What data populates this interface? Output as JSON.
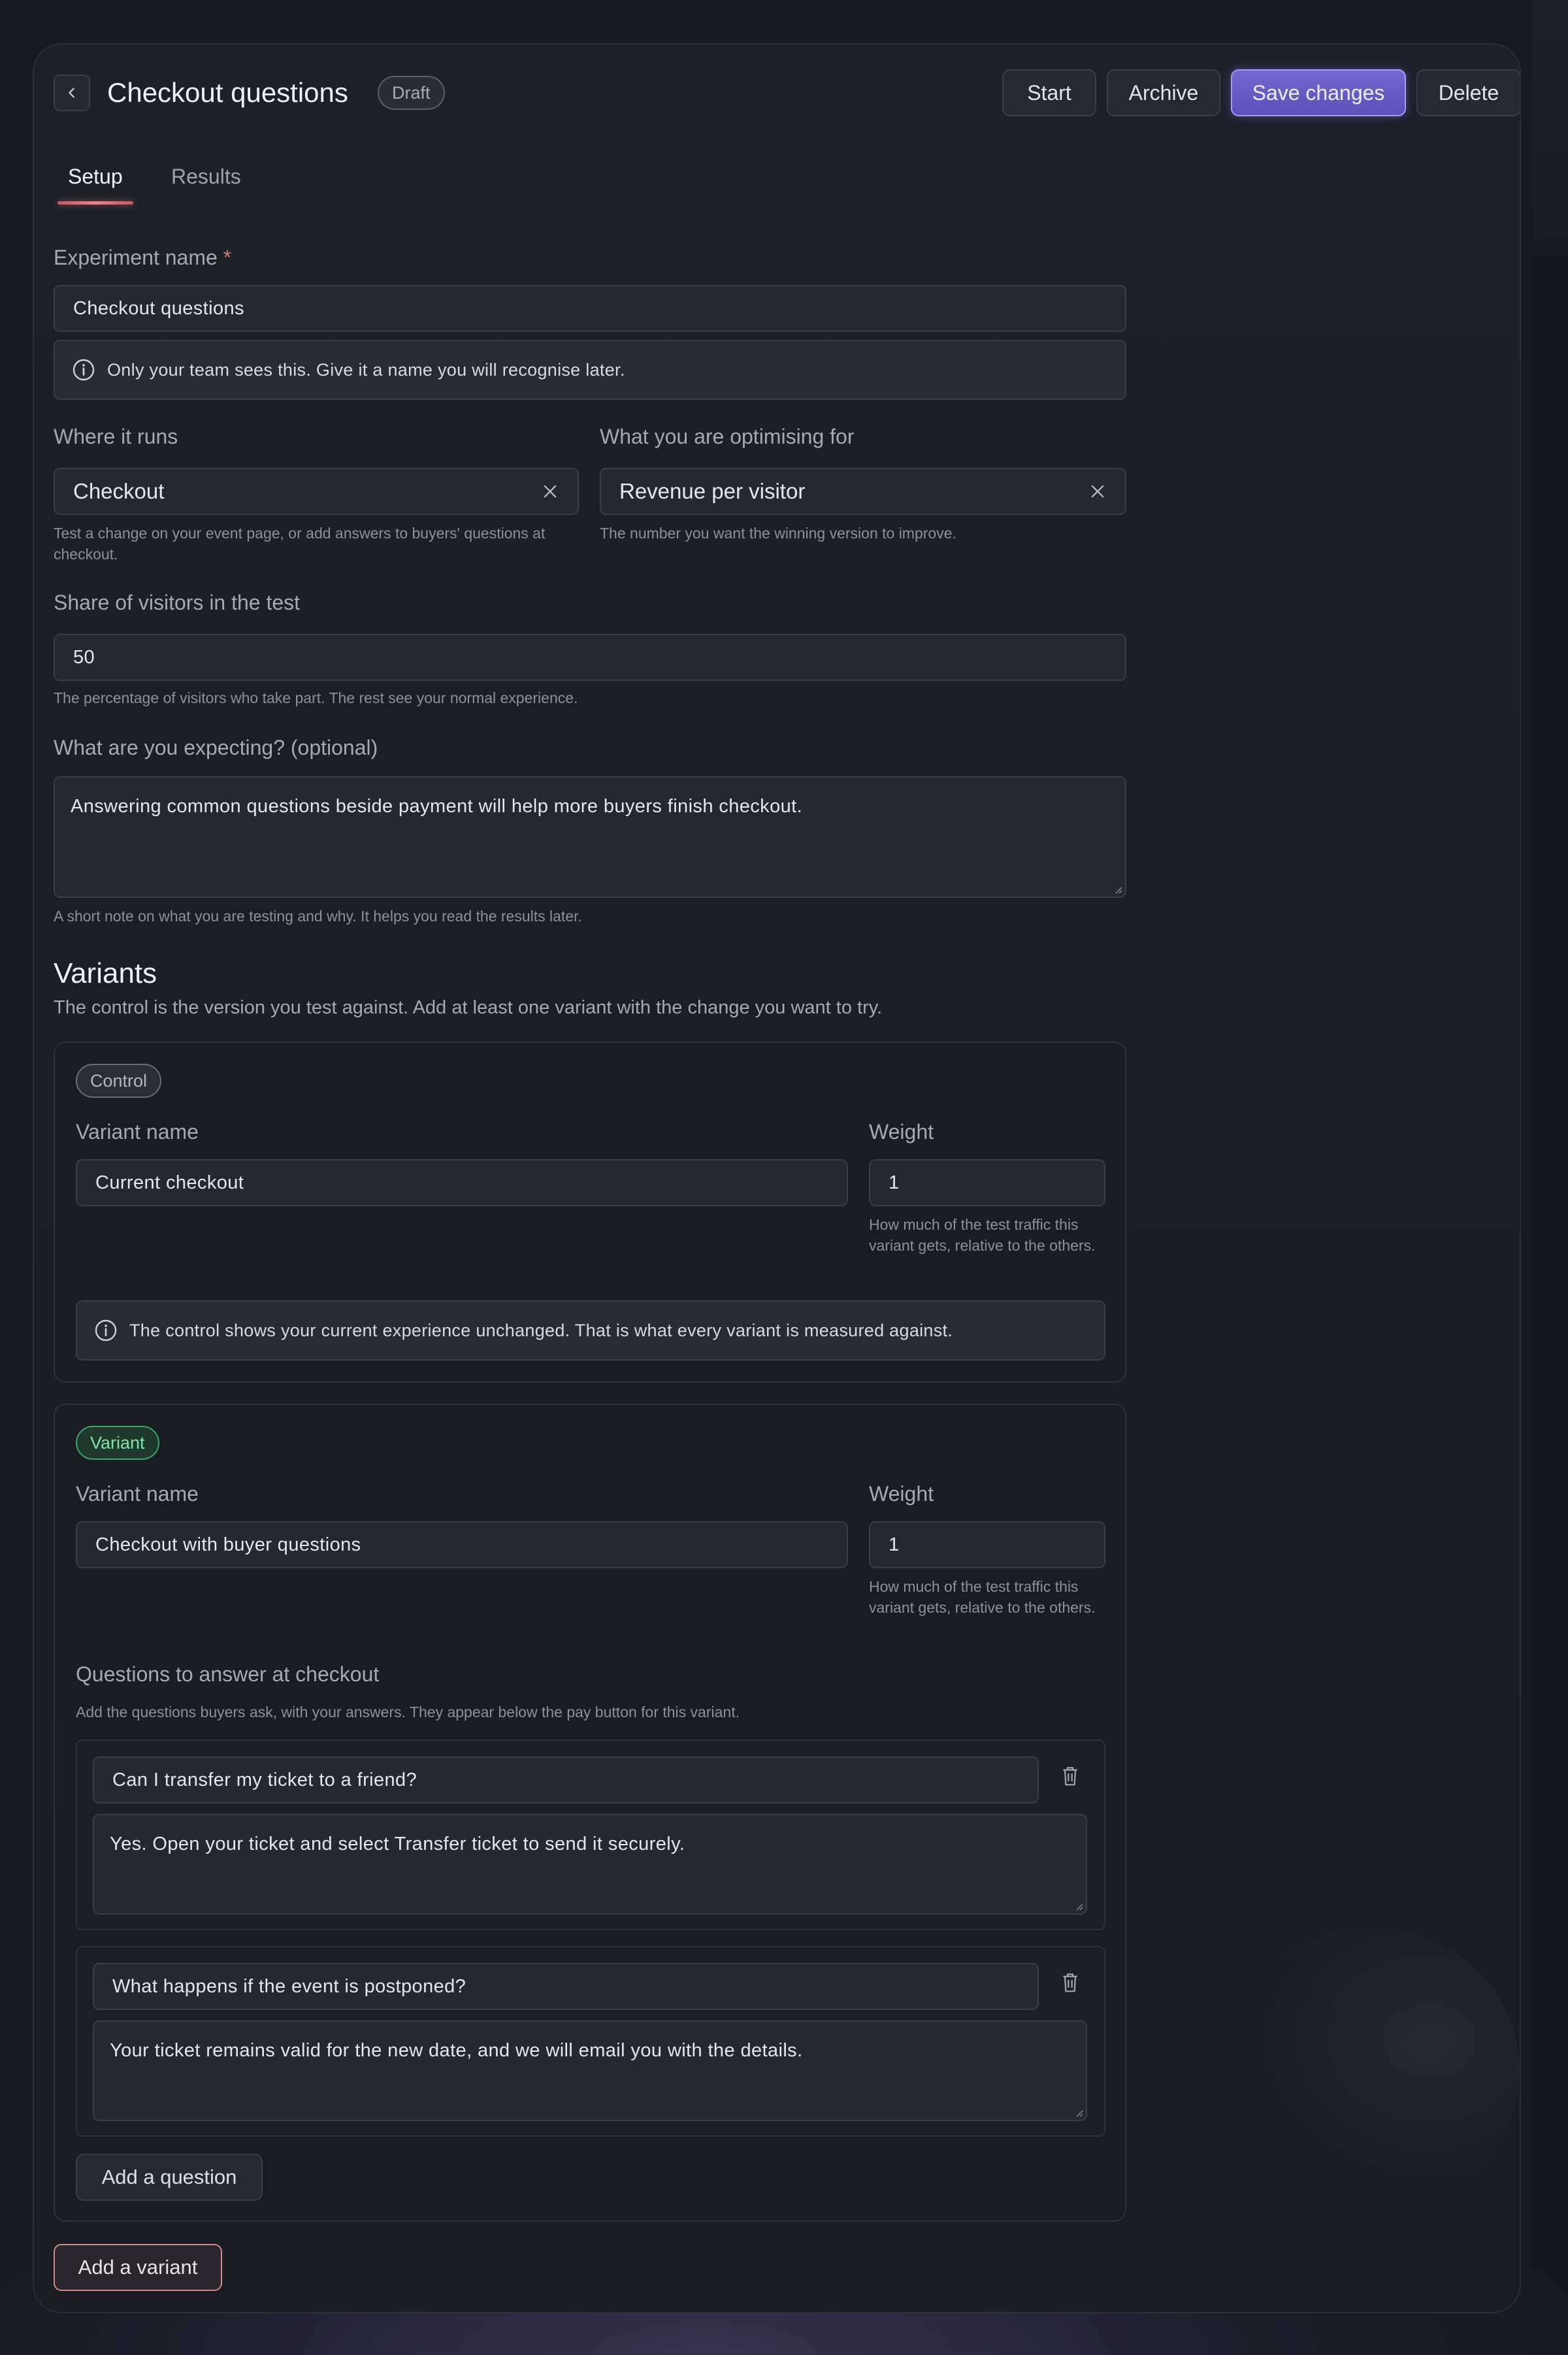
{
  "header": {
    "title": "Checkout questions",
    "status_badge": "Draft",
    "start_label": "Start",
    "archive_label": "Archive",
    "save_label": "Save changes",
    "delete_label": "Delete"
  },
  "tabs": [
    {
      "label": "Setup",
      "active": true
    },
    {
      "label": "Results",
      "active": false
    }
  ],
  "form": {
    "experiment_name": {
      "label": "Experiment name",
      "required_mark": "*",
      "value": "Checkout questions",
      "info": "Only your team sees this. Give it a name you will recognise later."
    },
    "where_it_runs": {
      "label": "Where it runs",
      "value": "Checkout",
      "help": "Test a change on your event page, or add answers to buyers' questions at checkout."
    },
    "optimising_for": {
      "label": "What you are optimising for",
      "value": "Revenue per visitor",
      "help": "The number you want the winning version to improve."
    },
    "share": {
      "label": "Share of visitors in the test",
      "value": "50",
      "help": "The percentage of visitors who take part. The rest see your normal experience."
    },
    "expectation": {
      "label": "What are you expecting? (optional)",
      "value": "Answering common questions beside payment will help more buyers finish checkout.",
      "help": "A short note on what you are testing and why. It helps you read the results later."
    }
  },
  "variants_section": {
    "title": "Variants",
    "subtitle": "The control is the version you test against. Add at least one variant with the change you want to try."
  },
  "control": {
    "badge": "Control",
    "name_label": "Variant name",
    "name_value": "Current checkout",
    "weight_label": "Weight",
    "weight_value": "1",
    "weight_help": "How much of the test traffic this variant gets, relative to the others.",
    "info": "The control shows your current experience unchanged. That is what every variant is measured against."
  },
  "variant": {
    "badge": "Variant",
    "name_label": "Variant name",
    "name_value": "Checkout with buyer questions",
    "weight_label": "Weight",
    "weight_value": "1",
    "weight_help": "How much of the test traffic this variant gets, relative to the others.",
    "questions_label": "Questions to answer at checkout",
    "questions_help": "Add the questions buyers ask, with your answers. They appear below the pay button for this variant.",
    "questions": [
      {
        "question": "Can I transfer my ticket to a friend?",
        "answer": "Yes. Open your ticket and select Transfer ticket to send it securely."
      },
      {
        "question": "What happens if the event is postponed?",
        "answer": "Your ticket remains valid for the new date, and we will email you with the details."
      }
    ],
    "add_question_label": "Add a question"
  },
  "add_variant_label": "Add a variant",
  "colors": {
    "accent": "#6b5cc6",
    "tab_underline": "#e28b8c",
    "variant_badge": "#3da56b",
    "background": "#161820"
  }
}
